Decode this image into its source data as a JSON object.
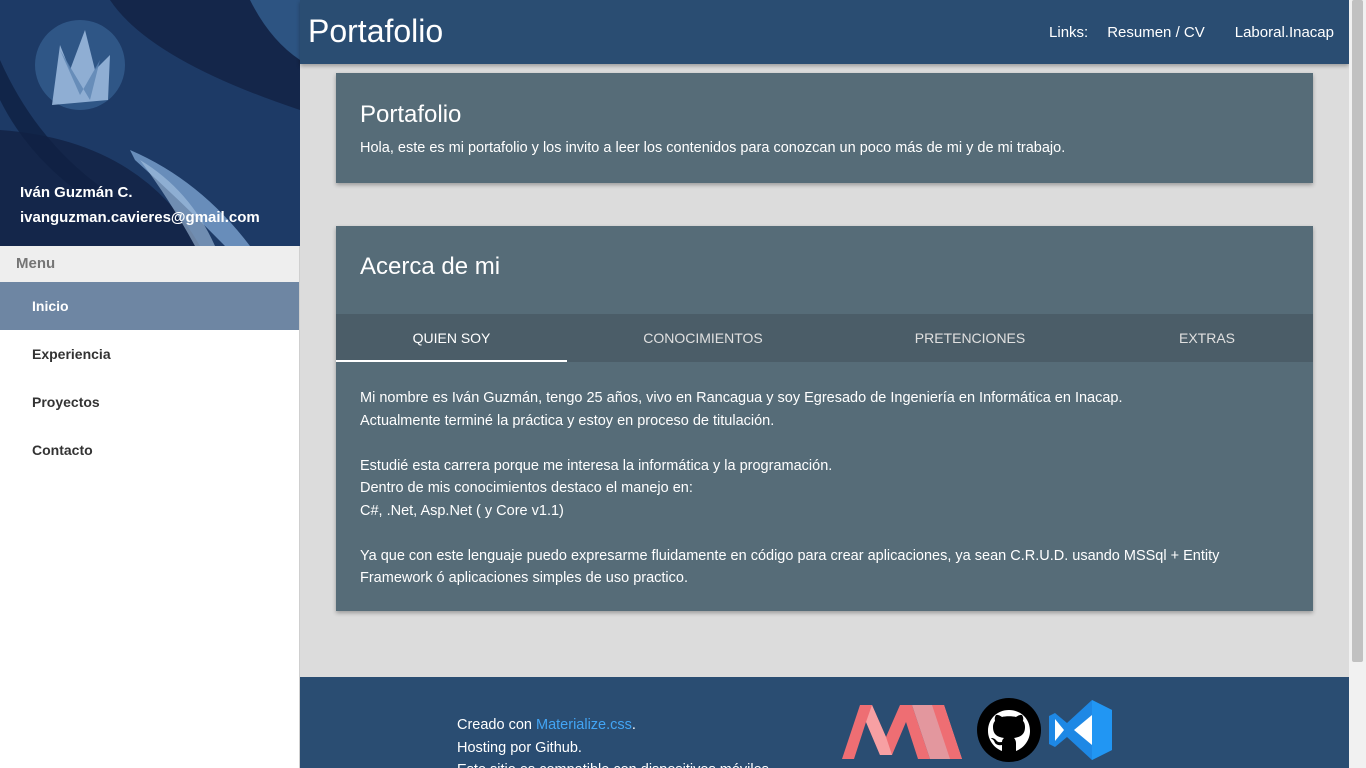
{
  "sidebar": {
    "user_name": "Iván Guzmán C.",
    "user_email": "ivanguzman.cavieres@gmail.com",
    "menu_header": "Menu",
    "items": [
      {
        "label": "Inicio",
        "active": true
      },
      {
        "label": "Experiencia",
        "active": false
      },
      {
        "label": "Proyectos",
        "active": false
      },
      {
        "label": "Contacto",
        "active": false
      }
    ]
  },
  "navbar": {
    "title": "Portafolio",
    "links_label": "Links:",
    "link1": "Resumen / CV",
    "link2": "Laboral.Inacap"
  },
  "card_portafolio": {
    "title": "Portafolio",
    "text": "Hola, este es mi portafolio y los invito a leer los contenidos para conozcan un poco más de mi y de mi trabajo."
  },
  "card_acerca": {
    "title": "Acerca de mi",
    "tabs": [
      "QUIEN SOY",
      "CONOCIMIENTOS",
      "PRETENCIONES",
      "EXTRAS"
    ],
    "active_tab": "QUIEN SOY",
    "content": {
      "p1_l1": "Mi nombre es Iván Guzmán, tengo 25 años, vivo en Rancagua y soy Egresado de Ingeniería en Informática en Inacap.",
      "p1_l2": "Actualmente terminé la práctica y estoy en proceso de titulación.",
      "p2_l1": "Estudié esta carrera porque me interesa la informática y la programación.",
      "p2_l2": "Dentro de mis conocimientos destaco el manejo en:",
      "p2_l3": "C#, .Net, Asp.Net ( y Core v1.1)",
      "p3": "Ya que con este lenguaje puedo expresarme fluidamente en código para crear aplicaciones, ya sean C.R.U.D. usando MSSql + Entity Framework ó aplicaciones simples de uso practico."
    }
  },
  "footer": {
    "created_prefix": "Creado con ",
    "created_link": "Materialize.css",
    "created_suffix": ".",
    "hosting": "Hosting por Github.",
    "compat": "Este sitio es compatible con dispositivos móviles."
  },
  "colors": {
    "navbar": "#2a4d72",
    "card": "#566c78",
    "tabs": "#4b5d68",
    "active_menu": "#6e86a3",
    "link": "#42a5f5"
  },
  "icons": [
    "materialize-logo-icon",
    "github-icon",
    "visual-studio-code-icon"
  ]
}
